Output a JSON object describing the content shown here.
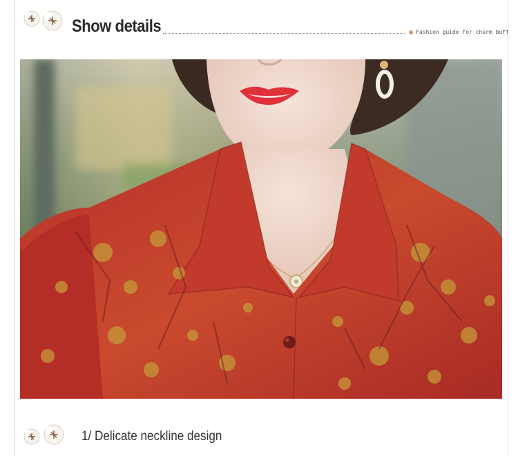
{
  "header": {
    "title": "Show details",
    "tagline": "Fashion guide for charm buff"
  },
  "caption": {
    "text": "1/ Delicate neckline design"
  },
  "colors": {
    "title": "#2a2a2a",
    "accent_dot": "#d89a6a",
    "frame": "#d8d8d8",
    "shirt_red": "#c0392b",
    "lipstick": "#e0303a"
  },
  "icons": {
    "decor": "cotton-flower-icon"
  }
}
